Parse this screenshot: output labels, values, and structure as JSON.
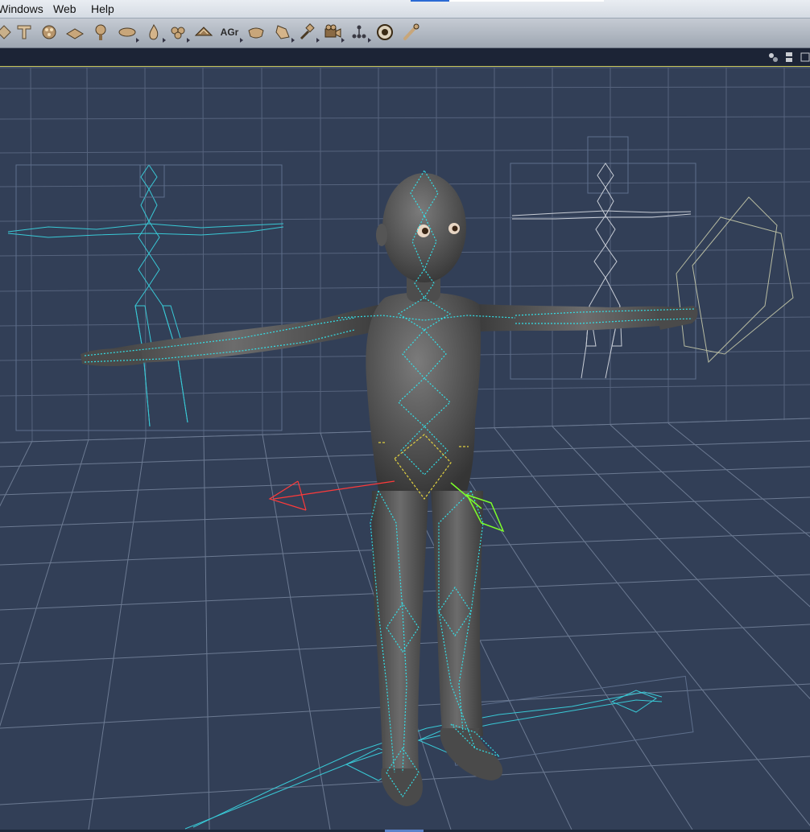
{
  "menubar": {
    "items": [
      "Windows",
      "Web",
      "Help"
    ]
  },
  "toolbar": {
    "tools": [
      {
        "name": "direct-manipulation-icon"
      },
      {
        "name": "translate-tool-icon"
      },
      {
        "name": "color-tool-icon"
      },
      {
        "name": "grouping-tool-icon"
      },
      {
        "name": "tree-tool-icon"
      },
      {
        "name": "bone-creation-tool-icon"
      },
      {
        "name": "taper-tool-icon"
      },
      {
        "name": "morph-putty-tool-icon"
      },
      {
        "name": "chain-break-tool-icon"
      },
      {
        "name": "label-text",
        "label": "AGr"
      },
      {
        "name": "scale-tool-icon"
      },
      {
        "name": "twist-tool-icon"
      },
      {
        "name": "view-magnifier-tool-icon"
      },
      {
        "name": "camera-tool-icon"
      },
      {
        "name": "joint-editor-icon"
      },
      {
        "name": "target-tool-icon"
      },
      {
        "name": "bone-tool-icon"
      }
    ]
  },
  "strip": {
    "icons": [
      "sync-icon",
      "layout-icon"
    ]
  },
  "viewport": {
    "figure": "T-pose human figure with cyan bone wireframe",
    "axis_color": "#ff3a3a",
    "bone_color": "#33e0e8",
    "selected_bone_color": "#7cff2a",
    "highlight_bone_color": "#e0d040",
    "grid_color": "#6c7a92"
  }
}
